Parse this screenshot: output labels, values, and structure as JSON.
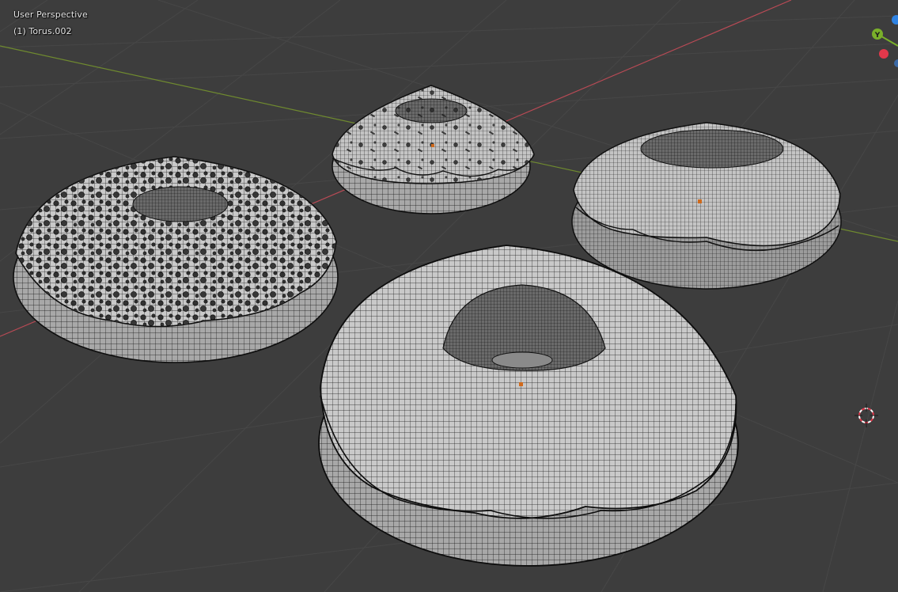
{
  "viewport": {
    "view_name": "User Perspective",
    "object_info": "(1) Torus.002"
  },
  "gizmo": {
    "y_axis_label": "Y",
    "colors": {
      "x_axis": "#e2384b",
      "y_axis": "#7ab02a",
      "z_axis": "#2f83e3"
    }
  },
  "scene": {
    "background": "#3d3d3d",
    "grid_color": "#464646",
    "x_axis_line_color": "#b84a55",
    "y_axis_line_color": "#6f8a2f",
    "objects": [
      {
        "name": "donut-back-left-sprinkled"
      },
      {
        "name": "donut-back-center-sprinkled"
      },
      {
        "name": "donut-right"
      },
      {
        "name": "donut-front-large"
      }
    ]
  },
  "icons": [
    "3d-cursor-icon",
    "navigation-gizmo-icon"
  ]
}
